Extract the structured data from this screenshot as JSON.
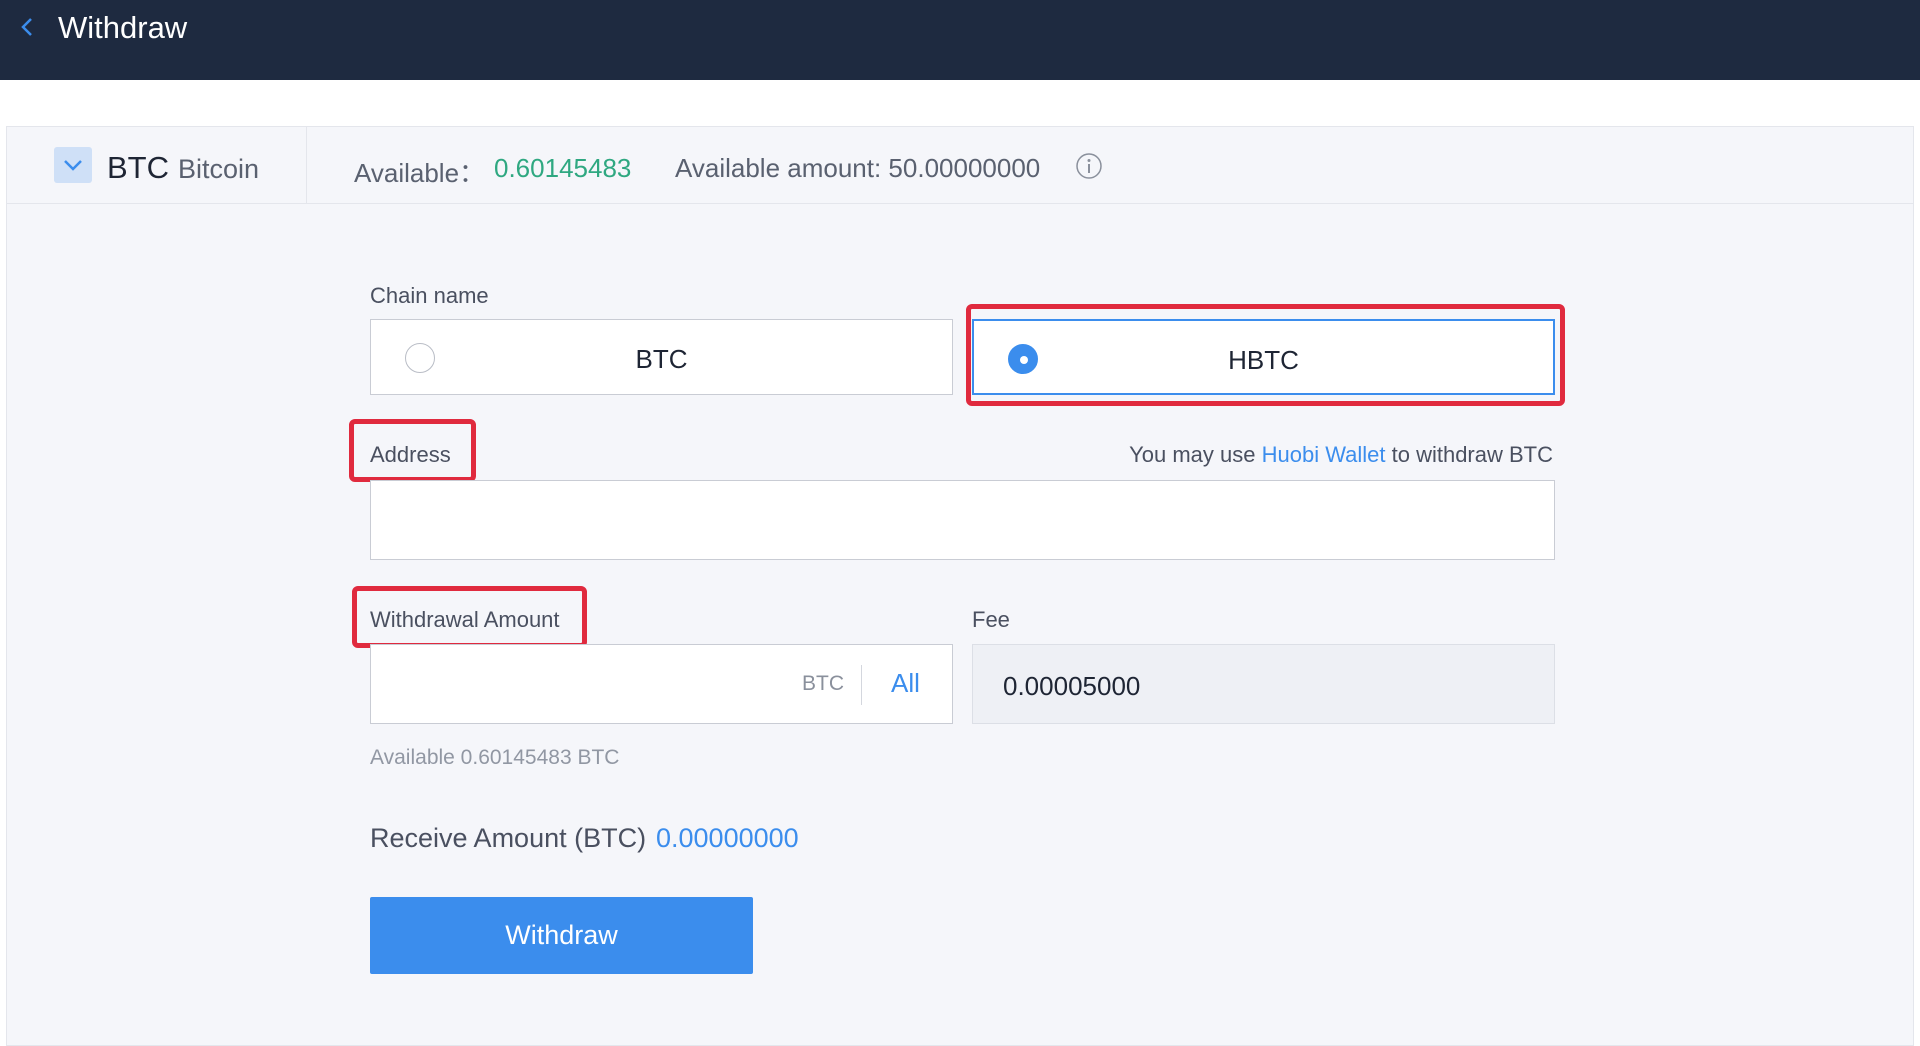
{
  "header": {
    "title": "Withdraw",
    "back_icon": "chevron-left-icon"
  },
  "coin": {
    "symbol": "BTC",
    "name": "Bitcoin",
    "dropdown_icon": "chevron-down-icon",
    "available_label": "Available：",
    "available_value": "0.60145483",
    "available_amount": "Available amount: 50.00000000",
    "info_icon": "info-icon"
  },
  "form": {
    "chain_label": "Chain name",
    "chains": [
      {
        "label": "BTC",
        "selected": false
      },
      {
        "label": "HBTC",
        "selected": true
      }
    ],
    "address_label": "Address",
    "address_value": "",
    "hint_prefix": "You may use ",
    "hint_link": "Huobi Wallet",
    "hint_suffix": " to withdraw BTC",
    "amount_label": "Withdrawal Amount",
    "amount_value": "",
    "amount_unit": "BTC",
    "all_label": "All",
    "fee_label": "Fee",
    "fee_value": "0.00005000",
    "available_note": "Available 0.60145483 BTC",
    "receive_label": "Receive Amount (BTC)",
    "receive_value": "0.00000000",
    "submit_label": "Withdraw"
  },
  "colors": {
    "topbar": "#1e2a40",
    "accent": "#3b8ded",
    "positive": "#2fa881",
    "highlight": "#e02a3e"
  }
}
